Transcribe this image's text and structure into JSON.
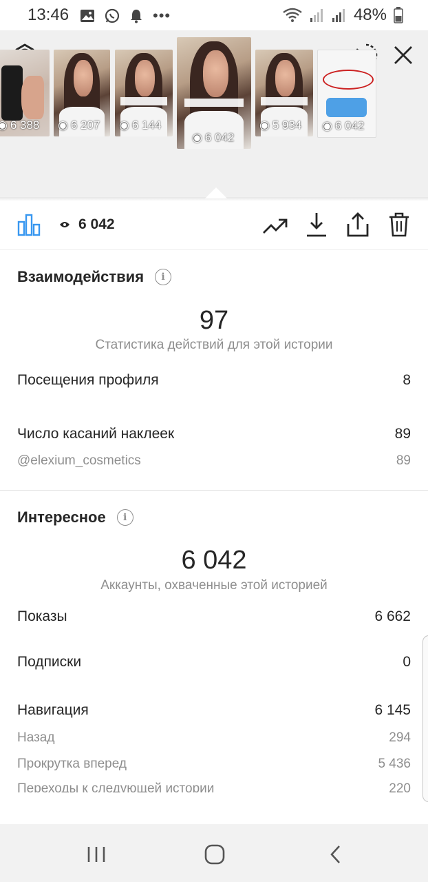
{
  "status_bar": {
    "time": "13:46",
    "battery": "48%"
  },
  "stories": [
    {
      "views": "6 388",
      "kind": "bottle"
    },
    {
      "views": "6 207",
      "kind": "person"
    },
    {
      "views": "6 144",
      "kind": "person"
    },
    {
      "views": "6 042",
      "kind": "person",
      "selected": true
    },
    {
      "views": "5 934",
      "kind": "person"
    },
    {
      "views": "6 042",
      "kind": "chat"
    }
  ],
  "toolbar": {
    "views": "6 042"
  },
  "interactions": {
    "title": "Взаимодействия",
    "total": "97",
    "total_caption": "Статистика действий для этой истории",
    "profile_visits_label": "Посещения профиля",
    "profile_visits_value": "8",
    "sticker_taps_label": "Число касаний наклеек",
    "sticker_taps_value": "89",
    "sticker_handle": "@elexium_cosmetics",
    "sticker_handle_value": "89"
  },
  "discovery": {
    "title": "Интересное",
    "reach": "6 042",
    "reach_caption": "Аккаунты, охваченные этой историей",
    "impressions_label": "Показы",
    "impressions_value": "6 662",
    "follows_label": "Подписки",
    "follows_value": "0",
    "navigation_label": "Навигация",
    "navigation_value": "6 145",
    "back_label": "Назад",
    "back_value": "294",
    "forward_label": "Прокрутка вперед",
    "forward_value": "5 436",
    "next_story_label": "Переходы к следующей истории",
    "next_story_value": "220"
  },
  "colors": {
    "accent": "#3897f0",
    "text": "#262626",
    "muted": "#8e8e8e"
  }
}
